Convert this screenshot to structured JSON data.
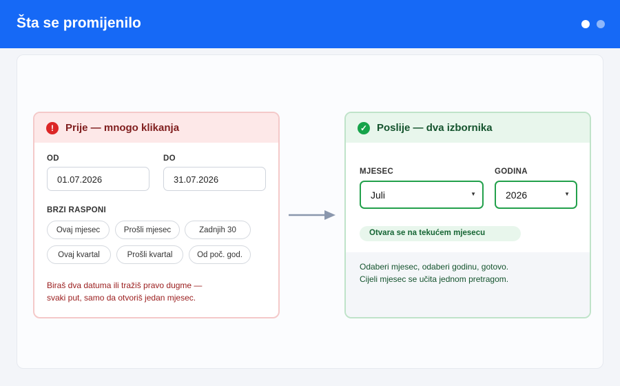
{
  "header": {
    "title": "Šta se promijenilo"
  },
  "before": {
    "title": "Prije — mnogo klikanja",
    "from_label": "OD",
    "from_value": "01.07.2026",
    "to_label": "DO",
    "to_value": "31.07.2026",
    "quick_label": "BRZI RASPONI",
    "chips": [
      "Ovaj mjesec",
      "Prošli mjesec",
      "Zadnjih 30",
      "Ovaj kvartal",
      "Prošli kvartal",
      "Od poč. god."
    ],
    "note_line1": "Biraš dva datuma ili tražiš pravo dugme —",
    "note_line2": "svaki put, samo da otvoriš jedan mjesec."
  },
  "after": {
    "title": "Poslije — dva izbornika",
    "month_label": "MJESEC",
    "month_value": "Juli",
    "year_label": "GODINA",
    "year_value": "2026",
    "badge": "Otvara se na tekućem mjesecu",
    "note_line1": "Odaberi mjesec, odaberi godinu, gotovo.",
    "note_line2": "Cijeli mjesec se učita jednom pretragom."
  },
  "icons": {
    "before": "error-icon",
    "after": "check-circle-icon",
    "arrow": "arrow-right-icon",
    "caret": "caret-down-icon"
  },
  "colors": {
    "brand": "#1669f6",
    "error": "#dc2626",
    "success": "#16a34a"
  }
}
